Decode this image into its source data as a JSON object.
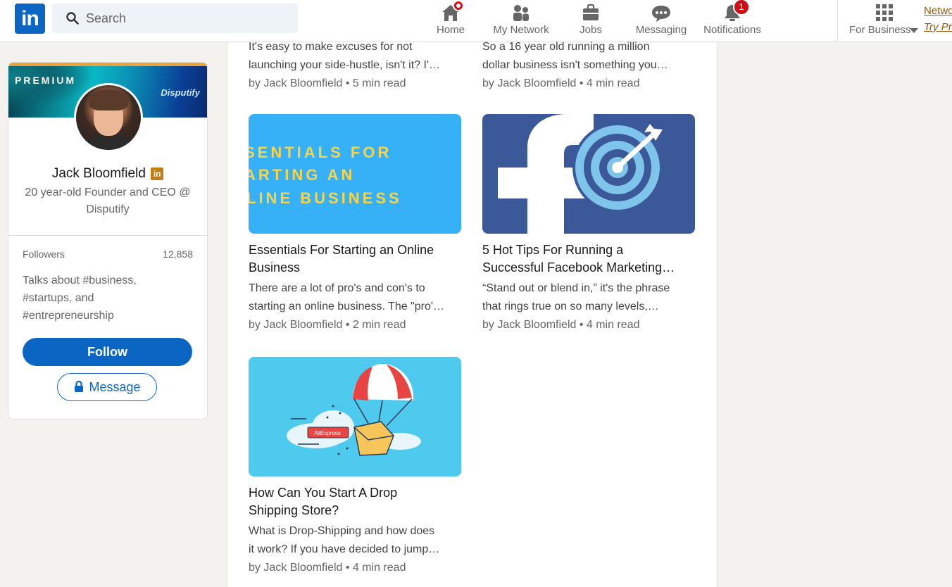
{
  "nav": {
    "logo": "in",
    "search_placeholder": "Search",
    "items": [
      {
        "label": "Home",
        "badge": ""
      },
      {
        "label": "My Network",
        "badge": ""
      },
      {
        "label": "Jobs",
        "badge": ""
      },
      {
        "label": "Messaging",
        "badge": ""
      },
      {
        "label": "Notifications",
        "badge": "1"
      }
    ],
    "for_business": "For Business",
    "promo_line1": "Netwo",
    "promo_line2": "Try Pre"
  },
  "profile": {
    "banner_label": "PREMIUM",
    "banner_brand": "Disputify",
    "name": "Jack Bloomfield",
    "headline": "20 year-old Founder and CEO @ Disputify",
    "followers_label": "Followers",
    "followers_count": "12,858",
    "talks_about": "Talks about #business, #startups, and #entrepreneurship",
    "follow_label": "Follow",
    "message_label": "Message"
  },
  "articles": [
    {
      "title": "",
      "snippet_line1": "It's easy to make excuses for not",
      "snippet_line2": "launching your side-hustle, isn't it? I'…",
      "meta": "by Jack Bloomfield • 5 min read"
    },
    {
      "title": "",
      "snippet_line1": "So a 16 year old running a million",
      "snippet_line2": "dollar business isn't something you…",
      "meta": "by Jack Bloomfield • 4 min read"
    },
    {
      "image_text": [
        "SENTIALS FOR",
        "ARTING AN",
        "LINE BUSINESS"
      ],
      "title_line1": "Essentials For Starting an Online",
      "title_line2": "Business",
      "snippet_line1": "There are a lot of pro's and con's to",
      "snippet_line2": "starting an online business. The \"pro'…",
      "meta": "by Jack Bloomfield • 2 min read"
    },
    {
      "title_line1": "5 Hot Tips For Running a",
      "title_line2": "Successful Facebook Marketing…",
      "snippet_line1": "“Stand out or blend in,” it's the phrase",
      "snippet_line2": "that rings true on so many levels,…",
      "meta": "by Jack Bloomfield • 4 min read"
    },
    {
      "image_text": "AliExpress",
      "title_line1": "How Can You Start A Drop",
      "title_line2": "Shipping Store?",
      "snippet_line1": "What is Drop-Shipping and how does",
      "snippet_line2": "it work? If you have decided to jump…",
      "meta": "by Jack Bloomfield • 4 min read"
    }
  ],
  "colors": {
    "brand_blue": "#0a66c2",
    "premium_gold": "#c37d16",
    "badge_red": "#cc1016"
  }
}
